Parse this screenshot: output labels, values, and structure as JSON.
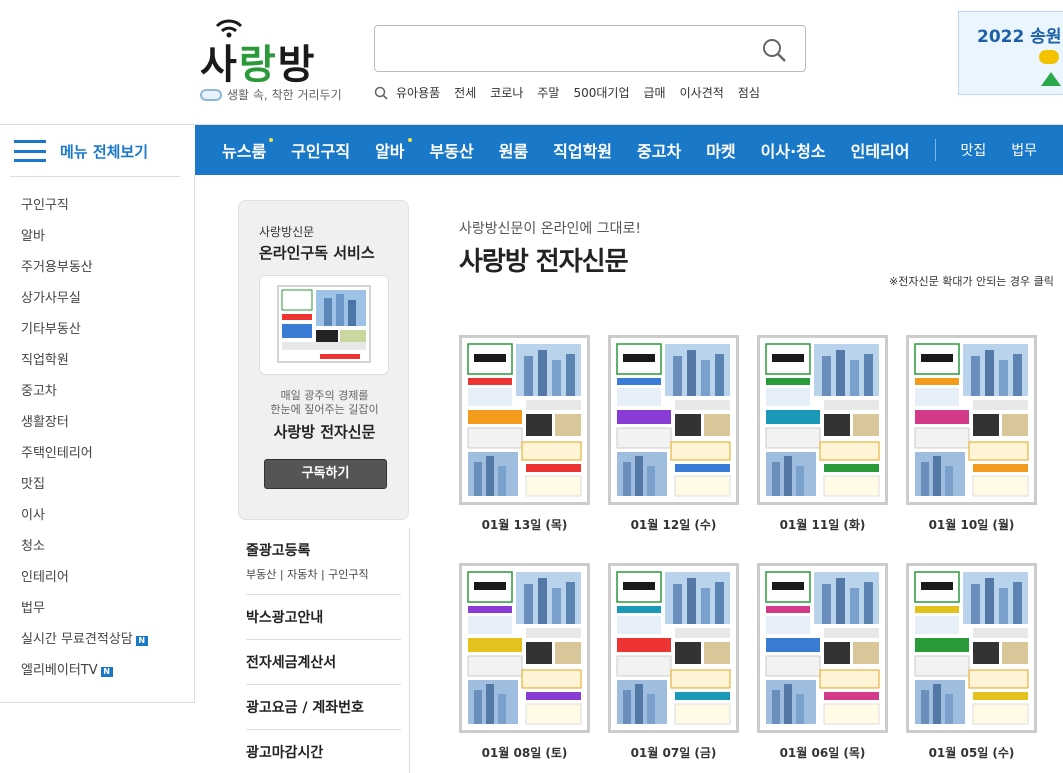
{
  "header": {
    "logo_text_1": "사",
    "logo_text_2": "랑",
    "logo_text_3": "방",
    "slogan": "생활 속, 착한 거리두기",
    "search_placeholder": "",
    "keywords": [
      "유아용품",
      "전세",
      "코로나",
      "주말",
      "500대기업",
      "급매",
      "이사견적",
      "점심"
    ],
    "banner_text": "2022 송원"
  },
  "sidebar": {
    "menu_label": "메뉴 전체보기",
    "items": [
      {
        "label": "구인구직"
      },
      {
        "label": "알바"
      },
      {
        "label": "주거용부동산"
      },
      {
        "label": "상가사무실"
      },
      {
        "label": "기타부동산"
      },
      {
        "label": "직업학원"
      },
      {
        "label": "중고차"
      },
      {
        "label": "생활장터"
      },
      {
        "label": "주택인테리어"
      },
      {
        "label": "맛집"
      },
      {
        "label": "이사"
      },
      {
        "label": "청소"
      },
      {
        "label": "인테리어"
      },
      {
        "label": "법무"
      },
      {
        "label": "실시간 무료견적상담",
        "badge": "N"
      },
      {
        "label": "엘리베이터TV",
        "badge": "N"
      }
    ]
  },
  "nav": {
    "items": [
      "뉴스룸",
      "구인구직",
      "알바",
      "부동산",
      "원룸",
      "직업학원",
      "중고차",
      "마켓",
      "이사·청소",
      "인테리어"
    ],
    "small_items": [
      "맛집",
      "법무"
    ]
  },
  "subscription": {
    "title1": "사랑방신문",
    "title2": "온라인구독 서비스",
    "desc1": "매일 광주의 경제를",
    "desc2": "한눈에 짚어주는 길잡이",
    "name": "사랑방 전자신문",
    "button": "구독하기"
  },
  "ads": [
    {
      "title": "줄광고등록",
      "subs": [
        "부동산",
        "자동차",
        "구인구직"
      ]
    },
    {
      "title": "박스광고안내"
    },
    {
      "title": "전자세금계산서"
    },
    {
      "title": "광고요금 / 계좌번호"
    },
    {
      "title": "광고마감시간"
    }
  ],
  "main": {
    "kicker": "사랑방신문이 온라인에 그대로!",
    "title": "사랑방 전자신문",
    "note": "※전자신문 확대가 안되는 경우 클릭"
  },
  "papers": [
    {
      "date": "01월 13일 (목)"
    },
    {
      "date": "01월 12일 (수)"
    },
    {
      "date": "01월 11일 (화)"
    },
    {
      "date": "01월 10일 (월)"
    },
    {
      "date": "01월 08일 (토)"
    },
    {
      "date": "01월 07일 (금)"
    },
    {
      "date": "01월 06일 (목)"
    },
    {
      "date": "01월 05일 (수)"
    }
  ],
  "colors": {
    "brand_blue": "#1a78c9",
    "logo_green": "#2a9a3a",
    "nav_dot": "#f2e24a"
  }
}
